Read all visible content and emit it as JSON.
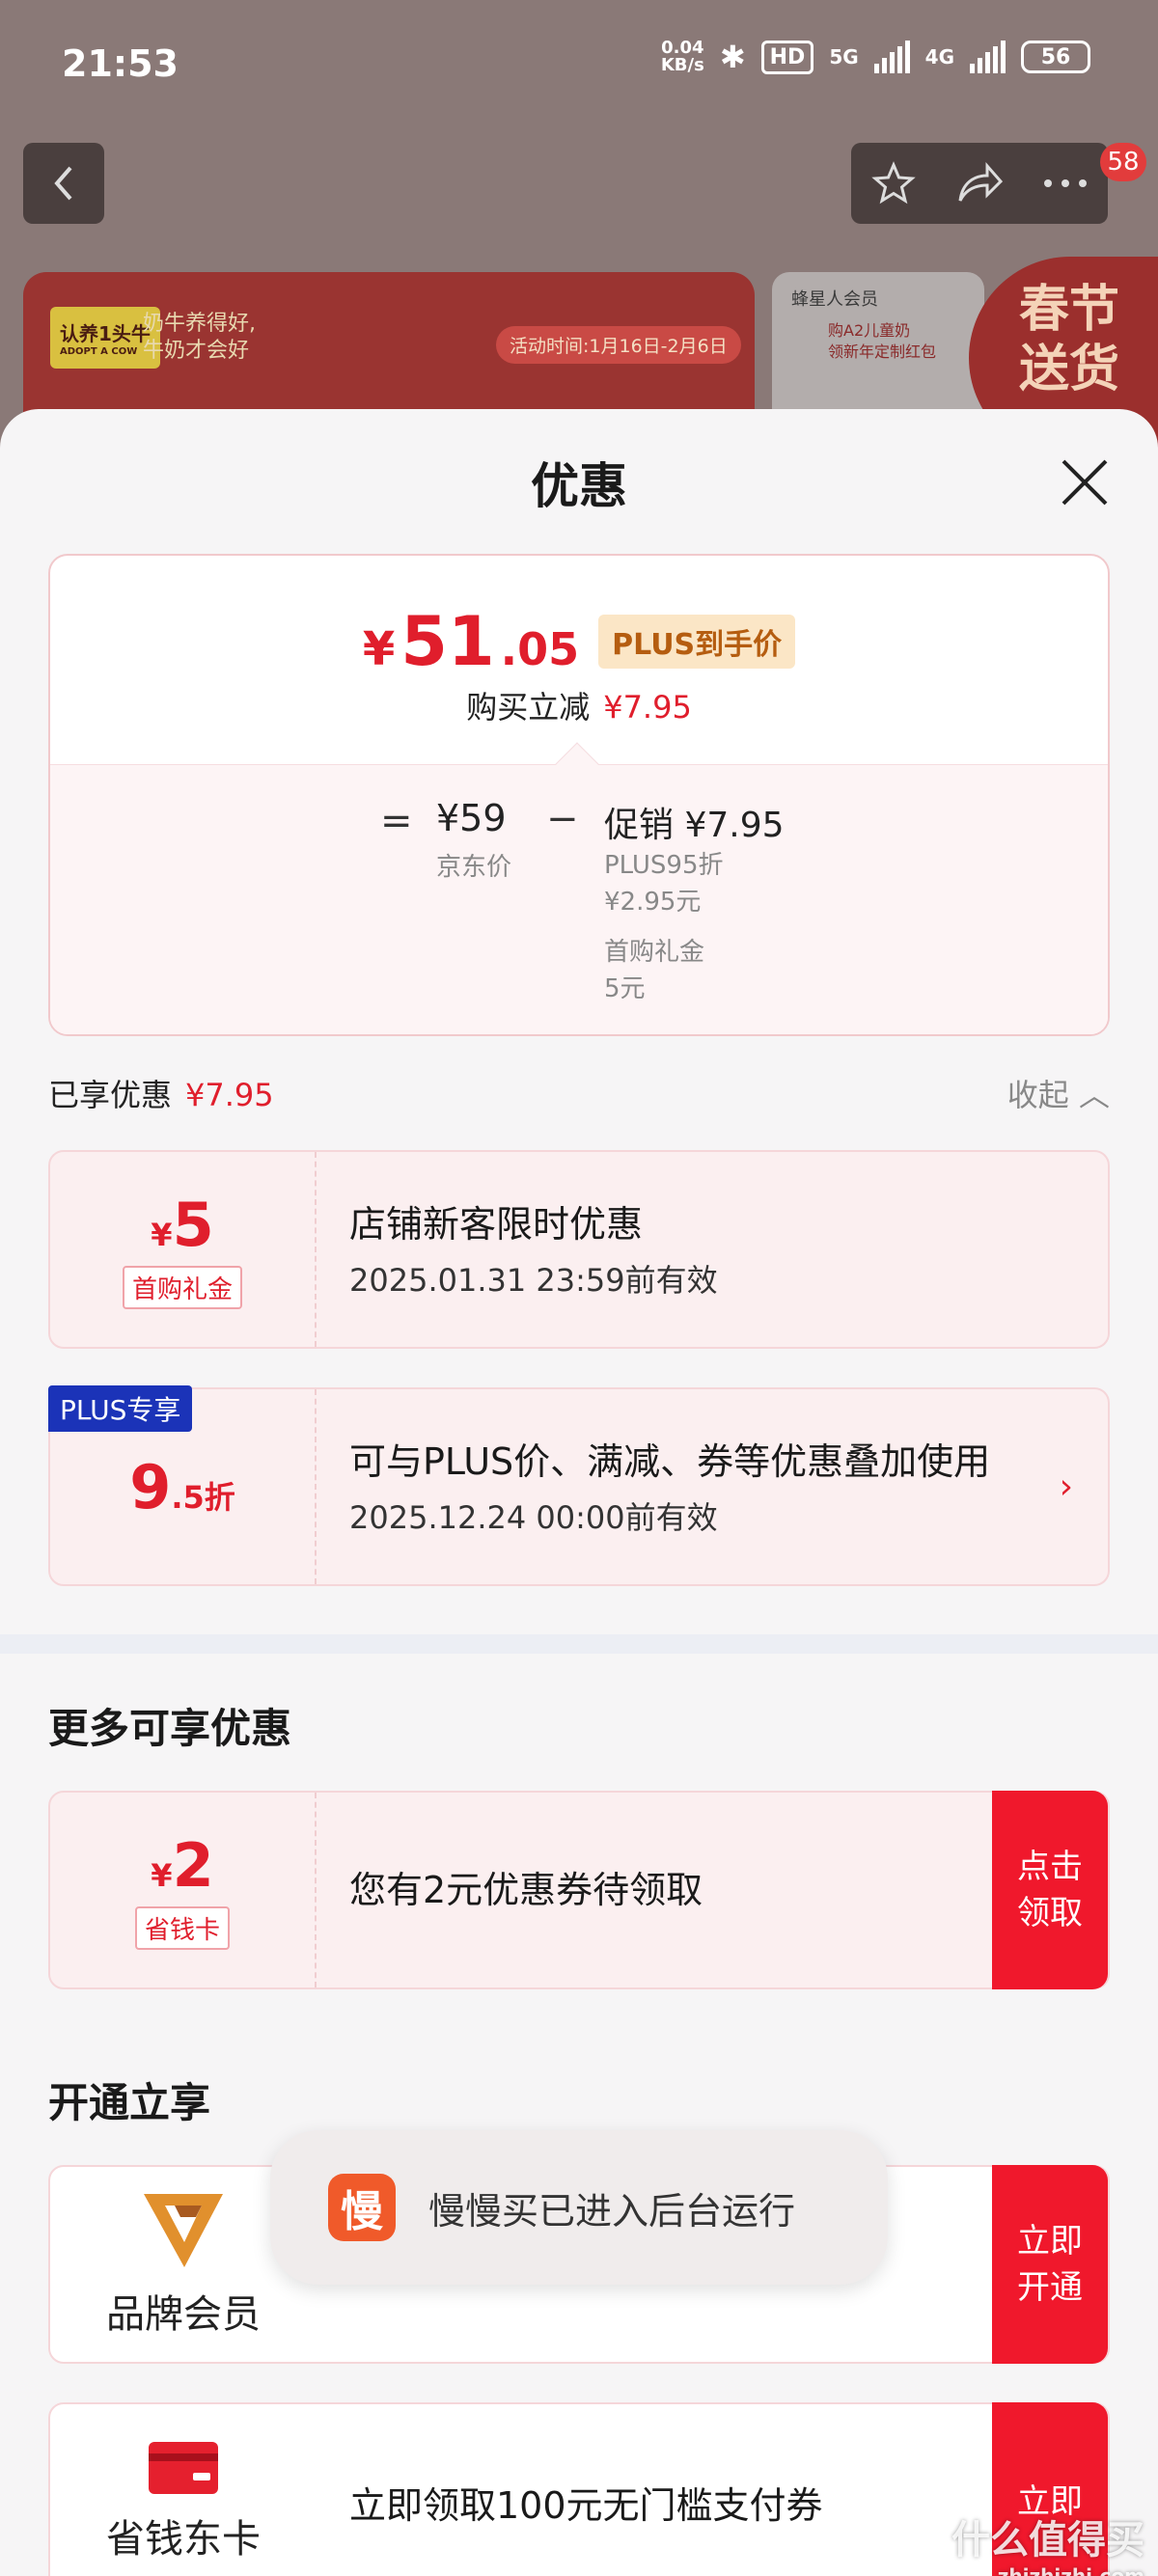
{
  "status": {
    "time": "21:53",
    "speed_top": "0.04",
    "speed_unit": "KB/s",
    "hd": "HD",
    "sig1": "5G",
    "sig2": "4G",
    "battery": "56"
  },
  "header": {
    "badge": "58"
  },
  "banner": {
    "logo": "认养1头牛",
    "logo_sub": "ADOPT A COW",
    "slogan_1": "奶牛养得好,",
    "slogan_2": "牛奶才会好",
    "date": "活动时间:1月16日-2月6日",
    "b2_title": "蜂星人会员",
    "b2_line1": "购A2儿童奶",
    "b2_line2": "领新年定制红包",
    "b3_text": "春节送货"
  },
  "sheet": {
    "title": "优惠"
  },
  "price": {
    "currency": "¥",
    "int": "51",
    "dec": ".05",
    "plus_tag": "PLUS到手价",
    "reduce_label": "购买立减",
    "reduce_value": "¥7.95",
    "eq": "=",
    "jd_price": "¥59",
    "jd_label": "京东价",
    "minus": "−",
    "promo": "促销 ¥7.95",
    "promo_d1": "PLUS95折",
    "promo_d2": "¥2.95元",
    "promo_d3": "首购礼金",
    "promo_d4": "5元"
  },
  "enjoyed": {
    "label": "已享优惠",
    "value": "¥7.95",
    "collapse": "收起"
  },
  "coupons": [
    {
      "small": "¥",
      "big": "5",
      "tag": "首购礼金",
      "title": "店铺新客限时优惠",
      "sub": "2025.01.31 23:59前有效"
    },
    {
      "corner": "PLUS专享",
      "big": "9",
      "small": ".5折",
      "title": "可与PLUS价、满减、券等优惠叠加使用",
      "sub": "2025.12.24 00:00前有效",
      "chev": "›"
    }
  ],
  "more": {
    "title": "更多可享优惠",
    "small": "¥",
    "big": "2",
    "tag": "省钱卡",
    "desc": "您有2元优惠券待领取",
    "cta": "点击领取"
  },
  "open": {
    "title": "开通立享",
    "brand_label": "品牌会员",
    "brand_cta": "立即开通",
    "card_label": "省钱东卡",
    "card_desc": "立即领取100元无门槛支付券",
    "card_cta": "立即"
  },
  "toast": {
    "icon": "慢",
    "msg": "慢慢买已进入后台运行"
  },
  "watermark": {
    "main": "什么值得买",
    "sub": "zhizhizhi.com"
  }
}
